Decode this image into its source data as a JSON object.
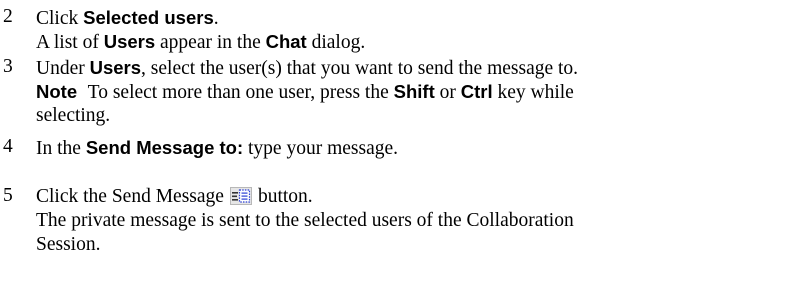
{
  "steps": [
    {
      "number": "2",
      "action_prefix": "Click ",
      "action_bold": "Selected users",
      "action_suffix": ".",
      "result_prefix": "A list of ",
      "result_bold1": "Users",
      "result_middle": " appear in the ",
      "result_bold2": "Chat",
      "result_suffix": " dialog."
    },
    {
      "number": "3",
      "action_prefix": "Under ",
      "action_bold": "Users",
      "action_suffix": ", select the user(s) that you want to send the message to.",
      "note_label": "Note",
      "note_text1": " To select more than one user, press the ",
      "note_bold1": "Shift",
      "note_text2": " or ",
      "note_bold2": "Ctrl",
      "note_text3": " key while",
      "note_line2": "selecting."
    },
    {
      "number": "4",
      "action_prefix": "In the ",
      "action_bold": "Send Message to:",
      "action_suffix": " type your message."
    },
    {
      "number": "5",
      "action_prefix": "Click the Send Message",
      "icon": "send-message-icon",
      "action_suffix": "button.",
      "result_line1": "The private message is sent to the selected users of the Collaboration",
      "result_line2": "Session."
    }
  ]
}
